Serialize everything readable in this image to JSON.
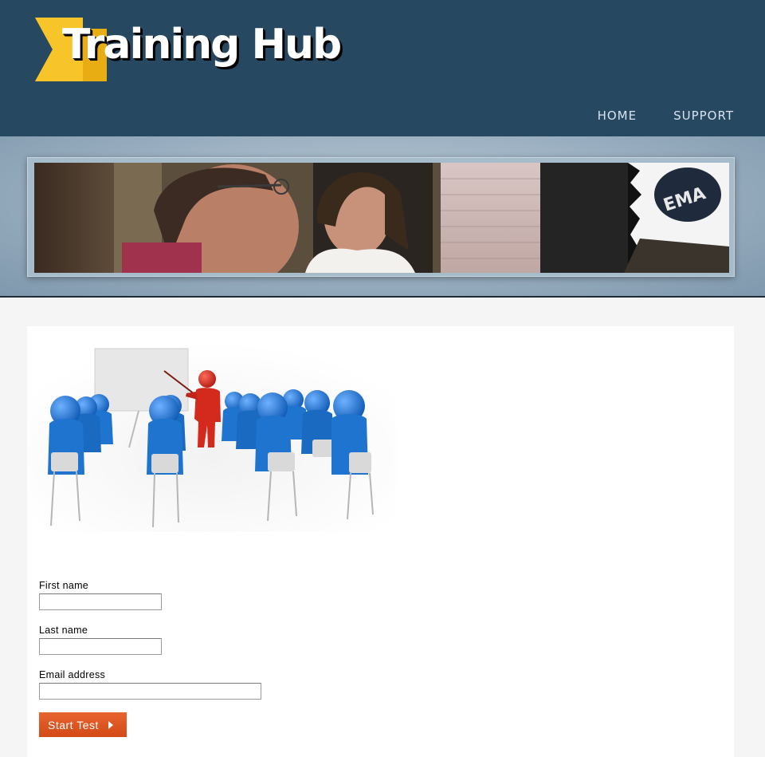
{
  "header": {
    "brand": "Training Hub",
    "nav": [
      {
        "label": "HOME"
      },
      {
        "label": "SUPPORT"
      }
    ]
  },
  "form": {
    "first_name_label": "First name",
    "first_name_value": "",
    "last_name_label": "Last name",
    "last_name_value": "",
    "email_label": "Email address",
    "email_value": "",
    "submit_label": "Start Test",
    "submit_icon": "triangle-right-icon"
  },
  "colors": {
    "header_bg": "#274861",
    "logo_yellow": "#f6c22a",
    "button_orange": "#d9541f",
    "trainee_blue": "#1f74cf",
    "trainer_red": "#d42a1e"
  }
}
